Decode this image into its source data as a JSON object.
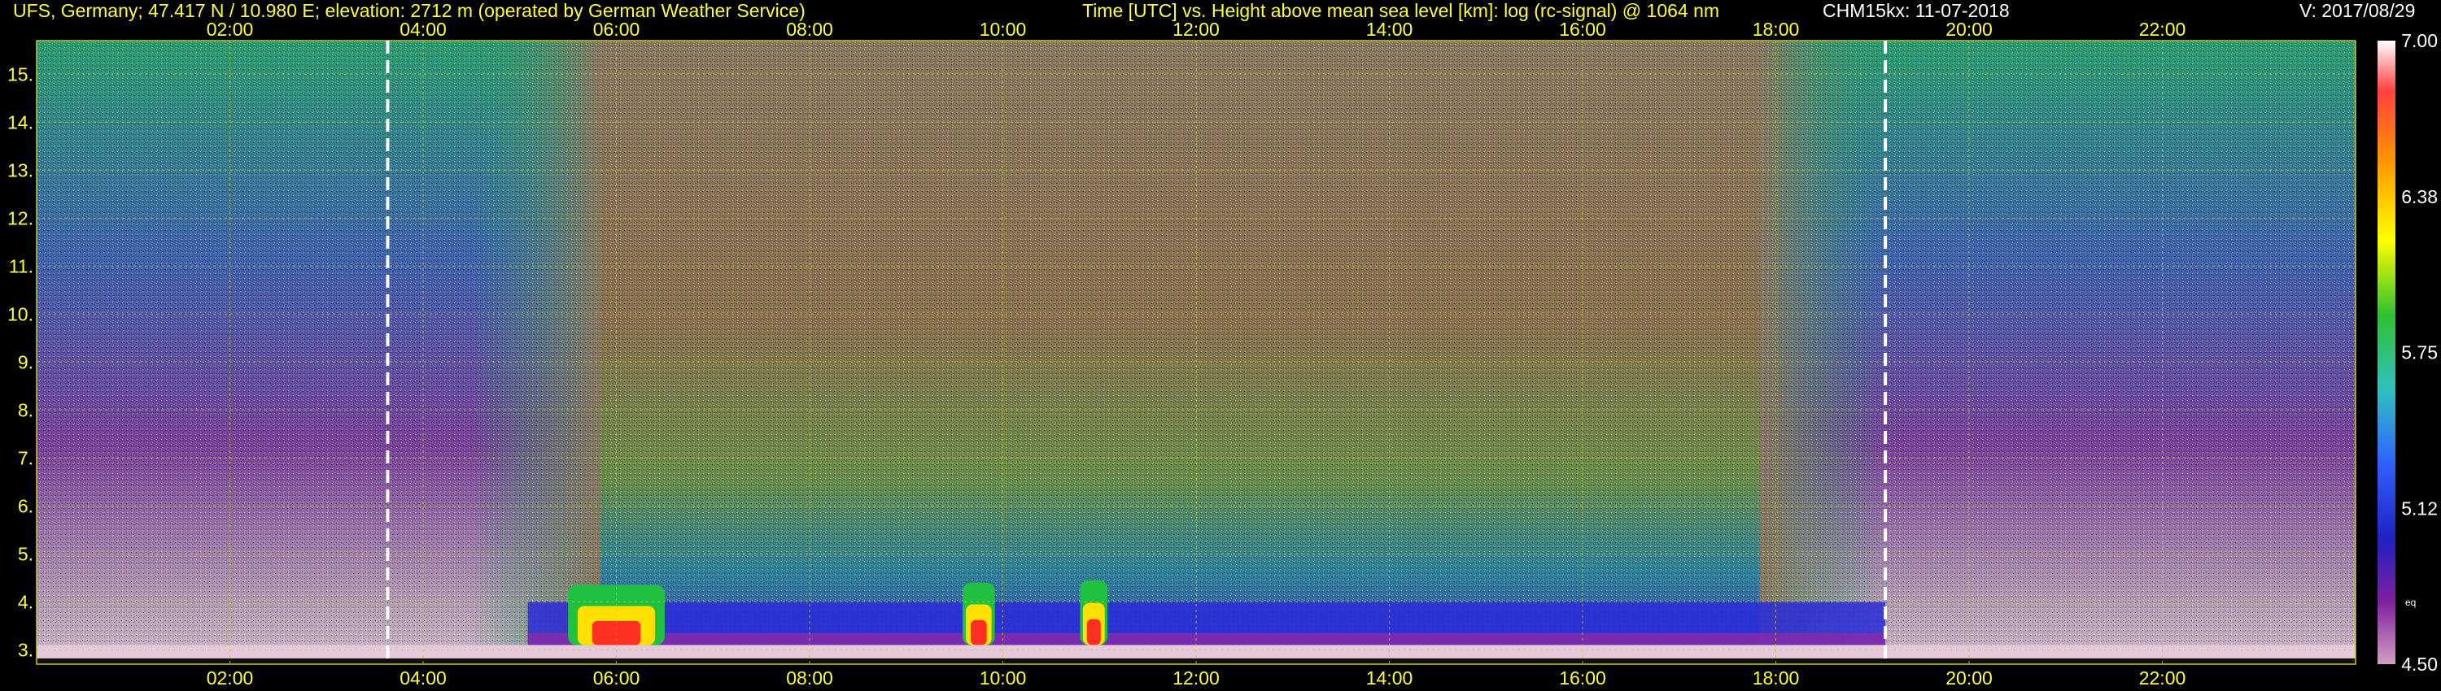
{
  "header": {
    "station": "UFS, Germany; 47.417 N / 10.980 E; elevation: 2712 m  (operated by German Weather Service)",
    "plot_title": "Time [UTC] vs. Height above mean sea level [km]: log (rc-signal) @ 1064 nm",
    "instrument_date": "CHM15kx: 11-07-2018",
    "version": "V: 2017/08/29"
  },
  "colors": {
    "background": "#000000",
    "axis_text": "#ffff33",
    "grid": "#c8c832",
    "terminator_line": "#ffffff"
  },
  "chart_data": {
    "type": "heatmap",
    "title": "Time [UTC] vs. Height above mean sea level [km]: log (rc-signal) @ 1064 nm",
    "xlabel": "Time [UTC]",
    "ylabel": "Height above mean sea level [km]",
    "xlim": [
      "00:00",
      "24:00"
    ],
    "ylim": [
      2.7,
      15.7
    ],
    "x_ticks": [
      "02:00",
      "04:00",
      "06:00",
      "08:00",
      "10:00",
      "12:00",
      "14:00",
      "16:00",
      "18:00",
      "20:00",
      "22:00"
    ],
    "y_ticks": [
      "3.",
      "4.",
      "5.",
      "6.",
      "7.",
      "8.",
      "9.",
      "10.",
      "11.",
      "12.",
      "13.",
      "14.",
      "15."
    ],
    "grid": true,
    "dashed_vertical_lines": [
      "03:38",
      "19:08"
    ],
    "colorbar": {
      "min": 4.5,
      "max": 7.0,
      "tick_labels": [
        "7.00",
        "6.38",
        "5.75",
        "5.12",
        "4.50"
      ],
      "small_label": "eq"
    },
    "cloud_layers": [
      {
        "start": "05:30",
        "end": "06:30",
        "base_km": 3.1,
        "top_km": 4.35
      },
      {
        "start": "09:35",
        "end": "09:55",
        "base_km": 3.1,
        "top_km": 4.4
      },
      {
        "start": "10:48",
        "end": "11:05",
        "base_km": 3.1,
        "top_km": 4.45
      }
    ],
    "aerosol_layer": {
      "start": "05:05",
      "end": "19:08",
      "top_km": 4.0
    }
  }
}
